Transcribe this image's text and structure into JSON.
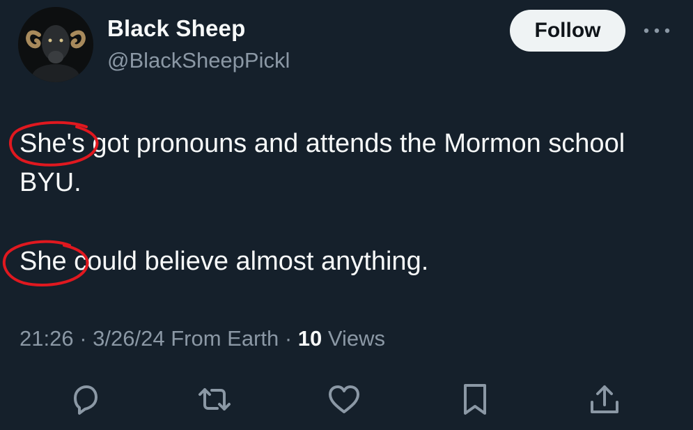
{
  "author": {
    "display_name": "Black Sheep",
    "handle": "@BlackSheepPickl"
  },
  "follow_label": "Follow",
  "tweet": {
    "paragraph1": "She's got pronouns and attends the Mormon school BYU.",
    "paragraph2": "She could believe almost anything."
  },
  "meta": {
    "time": "21:26",
    "date": "3/26/24",
    "source": "From Earth",
    "views_count": "10",
    "views_label": "Views"
  },
  "icons": {
    "more": "more-horizontal-icon",
    "reply": "reply-icon",
    "retweet": "retweet-icon",
    "like": "heart-icon",
    "bookmark": "bookmark-icon",
    "share": "share-icon"
  },
  "colors": {
    "background": "#15202b",
    "text": "#f7f9f9",
    "secondary_text": "#8b98a5",
    "annotation_red": "#e0181f",
    "button_bg": "#eff3f4"
  }
}
